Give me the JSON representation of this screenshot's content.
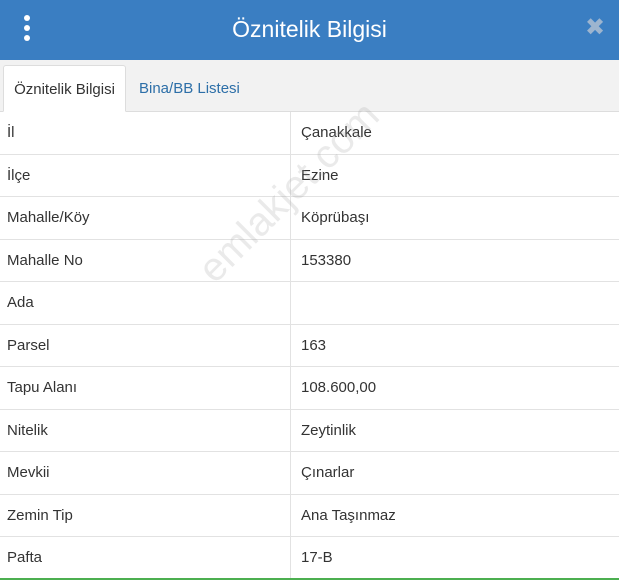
{
  "header": {
    "title": "Öznitelik Bilgisi",
    "background": "#3a7ec2",
    "menu_icon": "vertical-dots-icon",
    "close_icon": "close-icon",
    "close_glyph": "✖"
  },
  "tabs": [
    {
      "label": "Öznitelik Bilgisi",
      "active": true
    },
    {
      "label": "Bina/BB Listesi",
      "active": false
    }
  ],
  "rows": [
    {
      "key": "İl",
      "value": "Çanakkale"
    },
    {
      "key": "İlçe",
      "value": "Ezine"
    },
    {
      "key": "Mahalle/Köy",
      "value": "Köprübaşı"
    },
    {
      "key": "Mahalle No",
      "value": "153380"
    },
    {
      "key": "Ada",
      "value": ""
    },
    {
      "key": "Parsel",
      "value": "163"
    },
    {
      "key": "Tapu Alanı",
      "value": "108.600,00"
    },
    {
      "key": "Nitelik",
      "value": "Zeytinlik"
    },
    {
      "key": "Mevkii",
      "value": "Çınarlar"
    },
    {
      "key": "Zemin Tip",
      "value": "Ana Taşınmaz"
    },
    {
      "key": "Pafta",
      "value": "17-B"
    }
  ],
  "watermark": "emlakjet.com"
}
